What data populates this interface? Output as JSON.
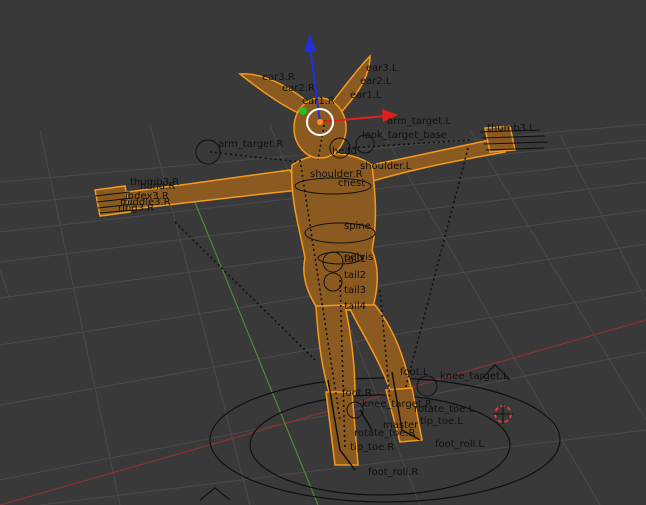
{
  "viewport": {
    "colors": {
      "background": "#393939",
      "grid": "#4a4a4a",
      "x_axis": "#8a3232",
      "y_axis": "#4e8a34",
      "mesh_fill": "#8a5a21",
      "mesh_edge": "#c8841e",
      "selection_outline": "#f39a1c",
      "bone_line": "#101010",
      "gizmo_x": "#e02020",
      "gizmo_y": "#20c020",
      "gizmo_z": "#2030e0",
      "cursor_ring": "#d84040"
    },
    "gizmo": {
      "x": "X",
      "y": "Y",
      "z": "Z",
      "icon": "transform-manipulator-icon"
    },
    "cursor": {
      "icon": "3d-cursor-icon"
    }
  },
  "labels": {
    "ear3_r": "ear3.R",
    "ear2_r": "ear2.R",
    "ear_r": "ear1.R",
    "ear3_l": "ear3.L",
    "ear2_l": "ear2.L",
    "ear1_l": "ear1.L",
    "arm_target_l": "arm_target.L",
    "arm_target_r": "arm_target.R",
    "head": "head",
    "target_base": "look_target_base",
    "shoulder_l": "shoulder.L",
    "shoulder_r": "shoulder.R",
    "chest": "chest",
    "spine": "spine",
    "pelvis": "pelvis",
    "tail1": "tail1",
    "tail2": "tail2",
    "tail3": "tail3",
    "tail4": "tail4",
    "hand_r": "hand.R",
    "thumb_r": "thumb3.R",
    "index_r": "index3.R",
    "middle_r": "middle3.R",
    "ring_r": "ring3.R",
    "hand_l": "thumb3.L",
    "foot_l": "foot.L",
    "knee_target_l": "knee_target.L",
    "knee_target_r": "knee_target.R",
    "foot_r": "foot.R",
    "rotate_toe_l": "rotate_toe.L",
    "tip_toe_l": "tip_toe.L",
    "master": "master",
    "rotate_toe_r": "rotate_toe.R",
    "tip_toe_r": "tip_toe.R",
    "foot_roll_l": "foot_roll.L",
    "foot_roll_r": "foot_roll.R"
  }
}
